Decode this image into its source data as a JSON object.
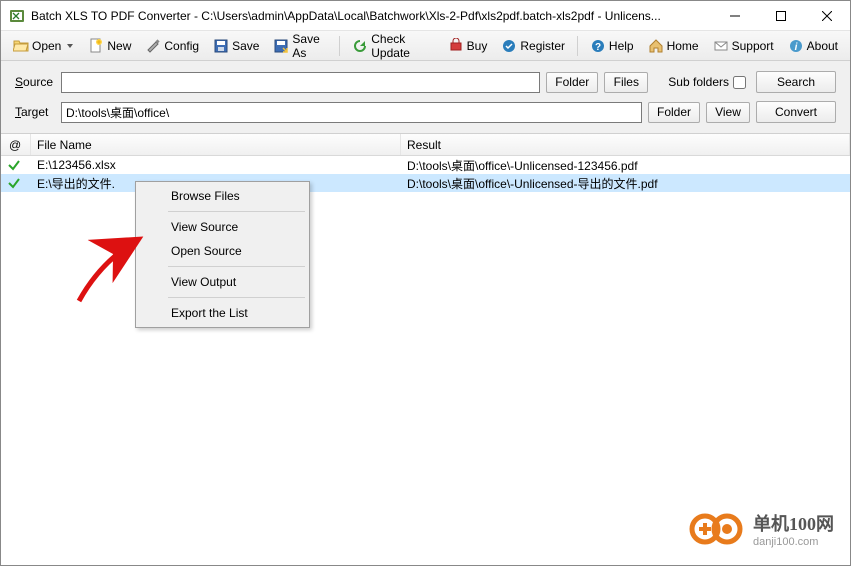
{
  "window": {
    "title": "Batch XLS TO PDF Converter - C:\\Users\\admin\\AppData\\Local\\Batchwork\\Xls-2-Pdf\\xls2pdf.batch-xls2pdf - Unlicens..."
  },
  "toolbar": {
    "open": "Open",
    "new": "New",
    "config": "Config",
    "save": "Save",
    "save_as": "Save As",
    "check_update": "Check Update",
    "buy": "Buy",
    "register": "Register",
    "help": "Help",
    "home": "Home",
    "support": "Support",
    "about": "About"
  },
  "paths": {
    "source_label_pre": "S",
    "source_label_post": "ource",
    "source_value": "",
    "target_label_pre": "T",
    "target_label_post": "arget",
    "target_value": "D:\\tools\\桌面\\office\\",
    "folder_btn": "Folder",
    "files_btn": "Files",
    "view_btn": "View",
    "sub_folders_label": "Sub folders",
    "search_btn": "Search",
    "convert_btn": "Convert"
  },
  "table": {
    "header_at": "@",
    "header_filename": "File Name",
    "header_result": "Result",
    "rows": [
      {
        "filename": "E:\\123456.xlsx",
        "result": "D:\\tools\\桌面\\office\\-Unlicensed-123456.pdf",
        "selected": false
      },
      {
        "filename": "E:\\导出的文件.",
        "result": "D:\\tools\\桌面\\office\\-Unlicensed-导出的文件.pdf",
        "selected": true
      }
    ]
  },
  "context_menu": {
    "browse_files": "Browse Files",
    "view_source": "View  Source",
    "open_source": "Open Source",
    "view_output": "View  Output",
    "export_list": "Export the List"
  },
  "watermark": {
    "text": "单机100网",
    "sub": "danji100.com"
  }
}
